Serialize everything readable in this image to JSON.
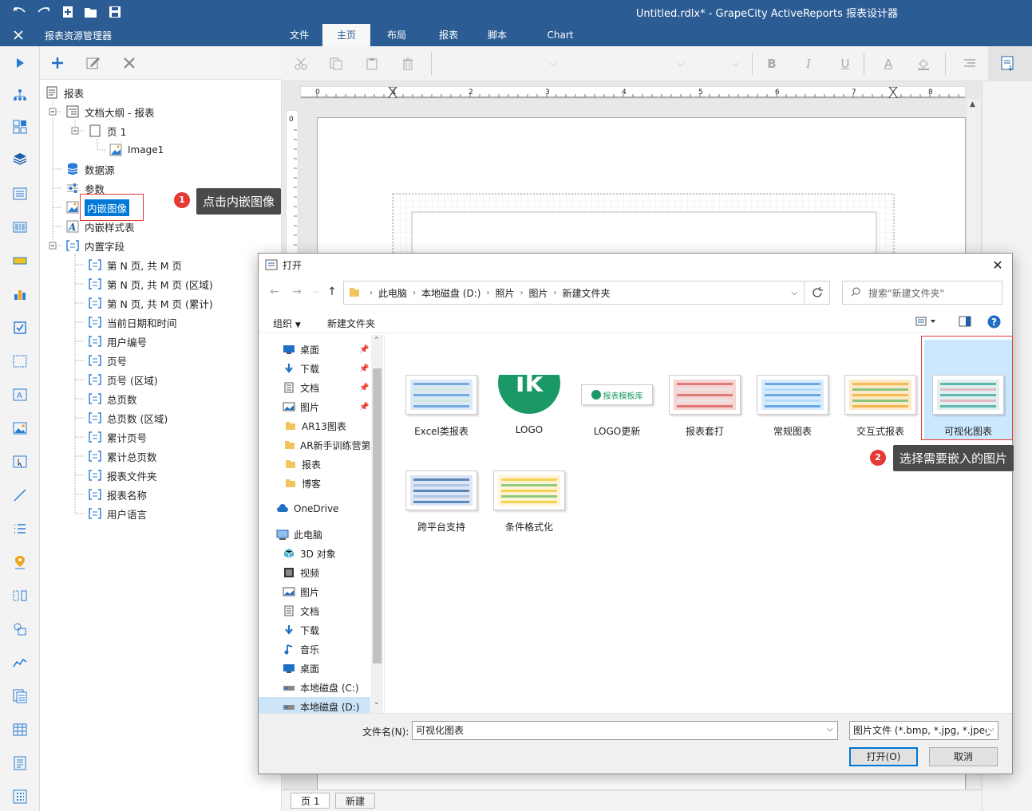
{
  "app": {
    "title": "Untitled.rdlx* - GrapeCity ActiveReports 报表设计器"
  },
  "ribbon": {
    "panel_title": "报表资源管理器",
    "tabs": [
      {
        "label": "文件"
      },
      {
        "label": "主页"
      },
      {
        "label": "布局"
      },
      {
        "label": "报表"
      },
      {
        "label": "脚本"
      },
      {
        "label": "Chart"
      }
    ],
    "active_tab": "主页"
  },
  "explorer": {
    "tree": {
      "report": "报表",
      "outline": "文档大纲 - 报表",
      "page1": "页 1",
      "image1": "Image1",
      "datasource": "数据源",
      "params": "参数",
      "embedded_images": "内嵌图像",
      "embedded_styles": "内嵌样式表",
      "builtin_fields": "内置字段",
      "fields": [
        "第 N 页, 共 M 页",
        "第 N 页, 共 M 页 (区域)",
        "第 N 页, 共 M 页 (累计)",
        "当前日期和时间",
        "用户编号",
        "页号",
        "页号 (区域)",
        "总页数",
        "总页数 (区域)",
        "累计页号",
        "累计总页数",
        "报表文件夹",
        "报表名称",
        "用户语言"
      ]
    }
  },
  "annotations": {
    "step1_badge": "1",
    "step1_text": "点击内嵌图像",
    "step2_badge": "2",
    "step2_text": "选择需要嵌入的图片"
  },
  "ruler": {
    "h_ticks": [
      "0",
      "1",
      "2",
      "3",
      "4",
      "5",
      "6",
      "7",
      "8"
    ],
    "v_ticks": [
      "0"
    ]
  },
  "bottom_tabs": {
    "page1": "页 1",
    "new": "新建"
  },
  "dialog": {
    "title": "打开",
    "breadcrumb": [
      "此电脑",
      "本地磁盘 (D:)",
      "照片",
      "图片",
      "新建文件夹"
    ],
    "search_placeholder": "搜索\"新建文件夹\"",
    "organize": "组织",
    "new_folder": "新建文件夹",
    "nav": [
      {
        "label": "桌面",
        "icon": "desktop-icon",
        "pinned": true
      },
      {
        "label": "下载",
        "icon": "download-icon",
        "pinned": true
      },
      {
        "label": "文档",
        "icon": "document-icon",
        "pinned": true
      },
      {
        "label": "图片",
        "icon": "picture-icon",
        "pinned": true
      },
      {
        "label": "AR13图表",
        "icon": "folder-icon",
        "pinned": false
      },
      {
        "label": "AR新手训练营第",
        "icon": "folder-icon",
        "pinned": false
      },
      {
        "label": "报表",
        "icon": "folder-icon",
        "pinned": false
      },
      {
        "label": "博客",
        "icon": "folder-icon",
        "pinned": false
      },
      {
        "label": "OneDrive",
        "icon": "cloud-icon",
        "pinned": false
      },
      {
        "label": "此电脑",
        "icon": "computer-icon",
        "pinned": false
      },
      {
        "label": "3D 对象",
        "icon": "cube-icon",
        "pinned": false
      },
      {
        "label": "视频",
        "icon": "video-icon",
        "pinned": false
      },
      {
        "label": "图片",
        "icon": "picture-icon",
        "pinned": false
      },
      {
        "label": "文档",
        "icon": "document-icon",
        "pinned": false
      },
      {
        "label": "下载",
        "icon": "download-icon",
        "pinned": false
      },
      {
        "label": "音乐",
        "icon": "music-icon",
        "pinned": false
      },
      {
        "label": "桌面",
        "icon": "desktop-icon",
        "pinned": false
      },
      {
        "label": "本地磁盘 (C:)",
        "icon": "drive-icon",
        "pinned": false
      },
      {
        "label": "本地磁盘 (D:)",
        "icon": "drive-icon",
        "pinned": false
      }
    ],
    "files": [
      {
        "label": "Excel类报表"
      },
      {
        "label": "LOGO",
        "logo_text": "ik"
      },
      {
        "label": "LOGO更新",
        "logo_text": "报表模板库"
      },
      {
        "label": "报表套打"
      },
      {
        "label": "常规图表"
      },
      {
        "label": "交互式报表"
      },
      {
        "label": "可视化图表"
      },
      {
        "label": "跨平台支持"
      },
      {
        "label": "条件格式化"
      }
    ],
    "selected_file": "可视化图表",
    "filename_label": "文件名(N):",
    "filename_value": "可视化图表",
    "filetype": "图片文件 (*.bmp, *.jpg, *.jpeg",
    "open_button": "打开(O)",
    "cancel_button": "取消"
  },
  "colors": {
    "titlebar": "#2c5c94",
    "accent": "#0078d7",
    "annotation_red": "#e53935"
  }
}
